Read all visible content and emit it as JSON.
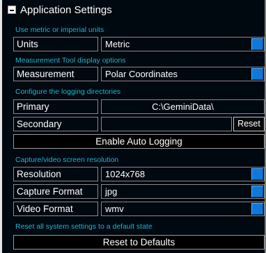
{
  "header": {
    "title": "Application Settings"
  },
  "units_section": {
    "caption": "Use metric or imperial units",
    "label": "Units",
    "value": "Metric"
  },
  "measurement_section": {
    "caption": "Measurement Tool display options",
    "label": "Measurement",
    "value": "Polar Coordinates"
  },
  "logging_section": {
    "caption": "Configure the logging directories",
    "primary_label": "Primary",
    "primary_value": "C:\\GeminiData\\",
    "secondary_label": "Secondary",
    "secondary_value": "",
    "reset_label": "Reset",
    "auto_logging_label": "Enable Auto Logging"
  },
  "capture_section": {
    "caption": "Capture/video screen resolution",
    "resolution_label": "Resolution",
    "resolution_value": "1024x768",
    "capture_format_label": "Capture Format",
    "capture_format_value": "jpg",
    "video_format_label": "Video Format",
    "video_format_value": "wmv"
  },
  "reset_section": {
    "caption": "Reset all system settings to a default state",
    "button_label": "Reset to Defaults"
  },
  "colors": {
    "background": "#000810",
    "caption": "#1bb6d0",
    "dropdown_button": "#1178d8",
    "border": "#8a8a8a"
  },
  "icons": {
    "collapse": "minus-square-icon",
    "dropdown": "dropdown-arrow-icon"
  }
}
